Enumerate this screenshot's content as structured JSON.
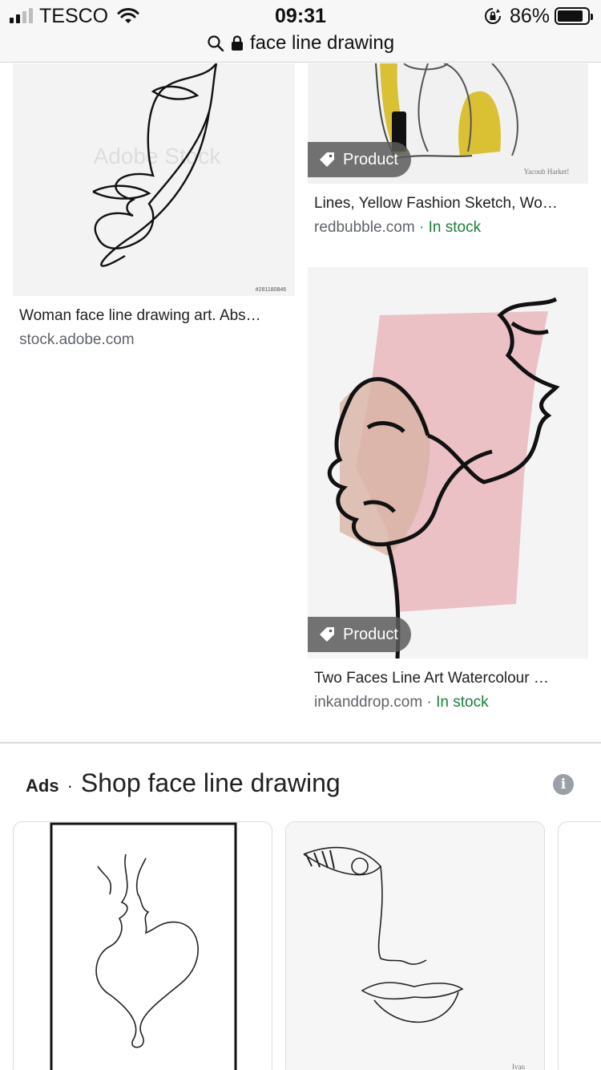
{
  "status_bar": {
    "carrier": "TESCO",
    "time": "09:31",
    "battery_percent": "86%",
    "battery_level": 0.86,
    "signal_bars_active": 2,
    "signal_bars_total": 4
  },
  "address_bar": {
    "query": "face line drawing",
    "icons": [
      "search-icon",
      "lock-icon"
    ]
  },
  "results": [
    {
      "title": "Woman face line drawing art. Abs…",
      "source": "stock.adobe.com",
      "stock_status": "",
      "badge": ""
    },
    {
      "title": "Lines, Yellow Fashion Sketch, Wo…",
      "source": "redbubble.com",
      "separator": "·",
      "stock_status": "In stock",
      "badge": "Product"
    },
    {
      "title": "Two Faces Line Art Watercolour …",
      "source": "inkanddrop.com",
      "separator": "·",
      "stock_status": "In stock",
      "badge": "Product"
    }
  ],
  "ads": {
    "label": "Ads",
    "separator": "·",
    "title": "Shop face line drawing",
    "info_icon": "i"
  },
  "colors": {
    "in_stock": "#188038",
    "badge_bg": "#5a5a5a",
    "divider": "#dadce0"
  }
}
